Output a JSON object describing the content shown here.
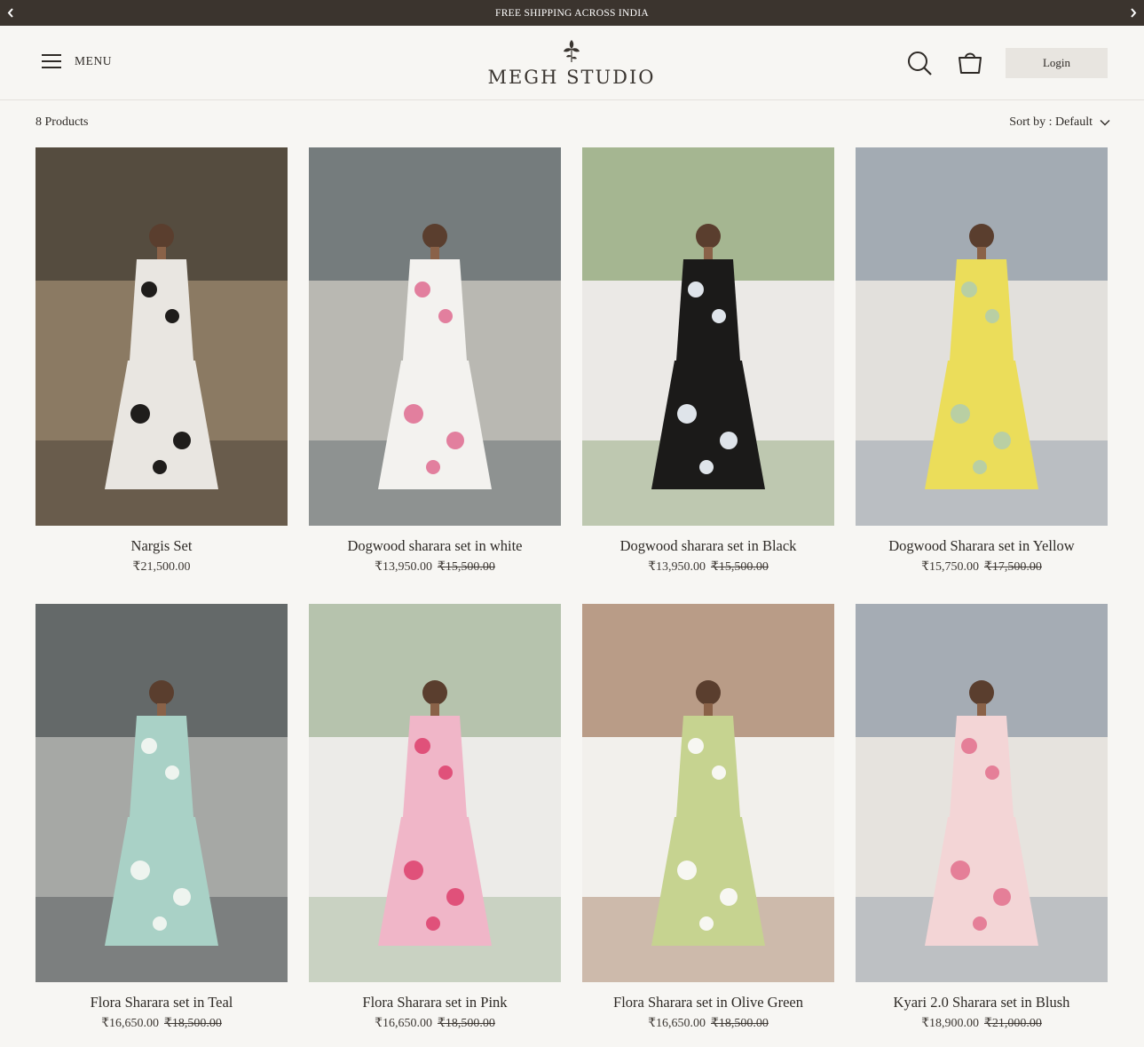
{
  "announcement": {
    "text": "FREE SHIPPING ACROSS INDIA"
  },
  "header": {
    "menu_label": "MENU",
    "logo_text": "MEGH STUDIO",
    "login_label": "Login"
  },
  "toolbar": {
    "product_count": "8 Products",
    "sort_label": "Sort by : Default"
  },
  "products": [
    {
      "name": "Nargis Set",
      "price": "₹21,500.00",
      "compare_price": "",
      "icon": "product-photo",
      "colors": {
        "bg": "#8b7a63",
        "top": "#2a2623",
        "outfit": "#e9e6e1",
        "print": "#1f1d1b"
      }
    },
    {
      "name": "Dogwood sharara set in white",
      "price": "₹13,950.00",
      "compare_price": "₹15,500.00",
      "icon": "product-photo",
      "colors": {
        "bg": "#b9b8b2",
        "top": "#3e4a52",
        "outfit": "#f3f2ef",
        "print": "#e27f9e"
      }
    },
    {
      "name": "Dogwood sharara set in Black",
      "price": "₹13,950.00",
      "compare_price": "₹15,500.00",
      "icon": "product-photo",
      "colors": {
        "bg": "#ebe9e6",
        "top": "#6b8c4a",
        "outfit": "#1b1a19",
        "print": "#dfe4ea"
      }
    },
    {
      "name": "Dogwood Sharara set in Yellow",
      "price": "₹15,750.00",
      "compare_price": "₹17,500.00",
      "icon": "product-photo",
      "colors": {
        "bg": "#e2e0dc",
        "top": "#6f7f92",
        "outfit": "#ebdd5a",
        "print": "#b9cfa3"
      }
    },
    {
      "name": "Flora Sharara set in Teal",
      "price": "₹16,650.00",
      "compare_price": "₹18,500.00",
      "icon": "product-photo",
      "colors": {
        "bg": "#a6a8a5",
        "top": "#2e3538",
        "outfit": "#a9d1c6",
        "print": "#eef4ef"
      }
    },
    {
      "name": "Flora Sharara set in Pink",
      "price": "₹16,650.00",
      "compare_price": "₹18,500.00",
      "icon": "product-photo",
      "colors": {
        "bg": "#ecebe8",
        "top": "#8aa37b",
        "outfit": "#f0b6c8",
        "print": "#e0517a"
      }
    },
    {
      "name": "Flora Sharara set in Olive Green",
      "price": "₹16,650.00",
      "compare_price": "₹18,500.00",
      "icon": "product-photo",
      "colors": {
        "bg": "#f2f0ec",
        "top": "#8a5734",
        "outfit": "#c6d390",
        "print": "#f7f7f2"
      }
    },
    {
      "name": "Kyari 2.0 Sharara set in Blush",
      "price": "₹18,900.00",
      "compare_price": "₹21,000.00",
      "icon": "product-photo",
      "colors": {
        "bg": "#e6e3de",
        "top": "#6f7f92",
        "outfit": "#f3d5d6",
        "print": "#e57f98"
      }
    }
  ]
}
